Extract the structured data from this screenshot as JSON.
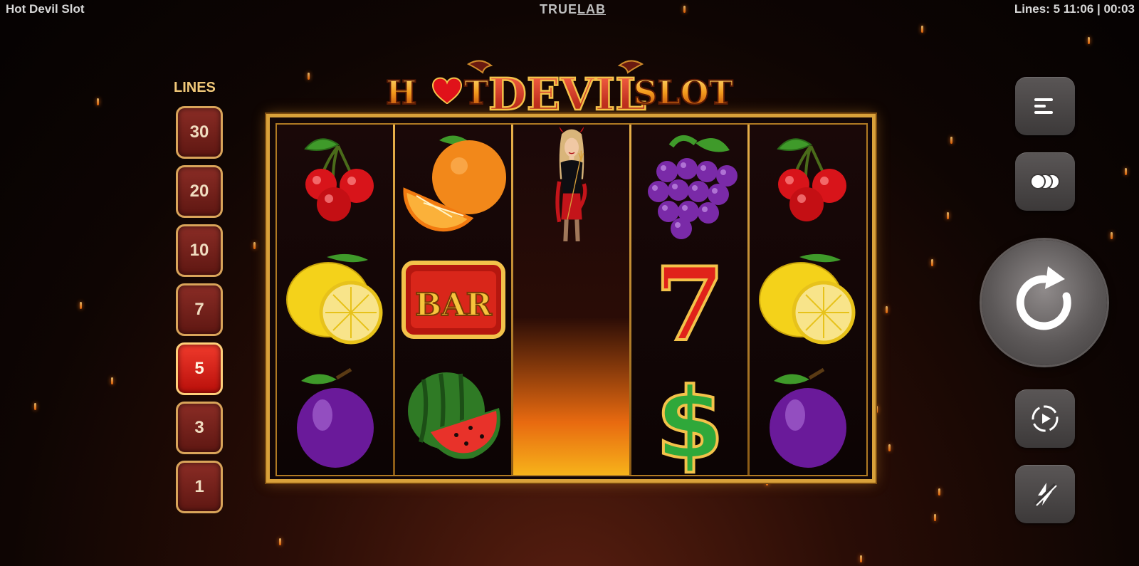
{
  "topbar": {
    "title": "Hot Devil Slot",
    "brand_true": "TRUE",
    "brand_lab": "LAB",
    "status": "Lines: 5  11:06 | 00:03"
  },
  "logo": {
    "hot": "H",
    "heart": "O",
    "t": "T",
    "devil": "DEVIL",
    "slot": "SLOT"
  },
  "lines": {
    "heading": "LINES",
    "options": [
      "30",
      "20",
      "10",
      "7",
      "5",
      "3",
      "1"
    ],
    "selected": "5"
  },
  "reels": [
    [
      "cherries",
      "lemon",
      "plum"
    ],
    [
      "orange",
      "bar",
      "watermelon"
    ],
    [
      "devil-wild",
      "devil-wild",
      "devil-wild"
    ],
    [
      "grapes",
      "seven",
      "dollar"
    ],
    [
      "cherries",
      "lemon",
      "plum"
    ]
  ],
  "symbols": {
    "bar_text": "BAR",
    "seven_text": "7",
    "dollar_text": "$"
  },
  "controls": {
    "menu_icon": "menu-icon",
    "bet_icon": "coins-icon",
    "spin_icon": "spin-icon",
    "autoplay_icon": "autoplay-icon",
    "turbo_icon": "turbo-icon"
  },
  "colors": {
    "gold": "#d9a13a",
    "active_line": "#e8281d",
    "line_button": "#7a241e"
  }
}
